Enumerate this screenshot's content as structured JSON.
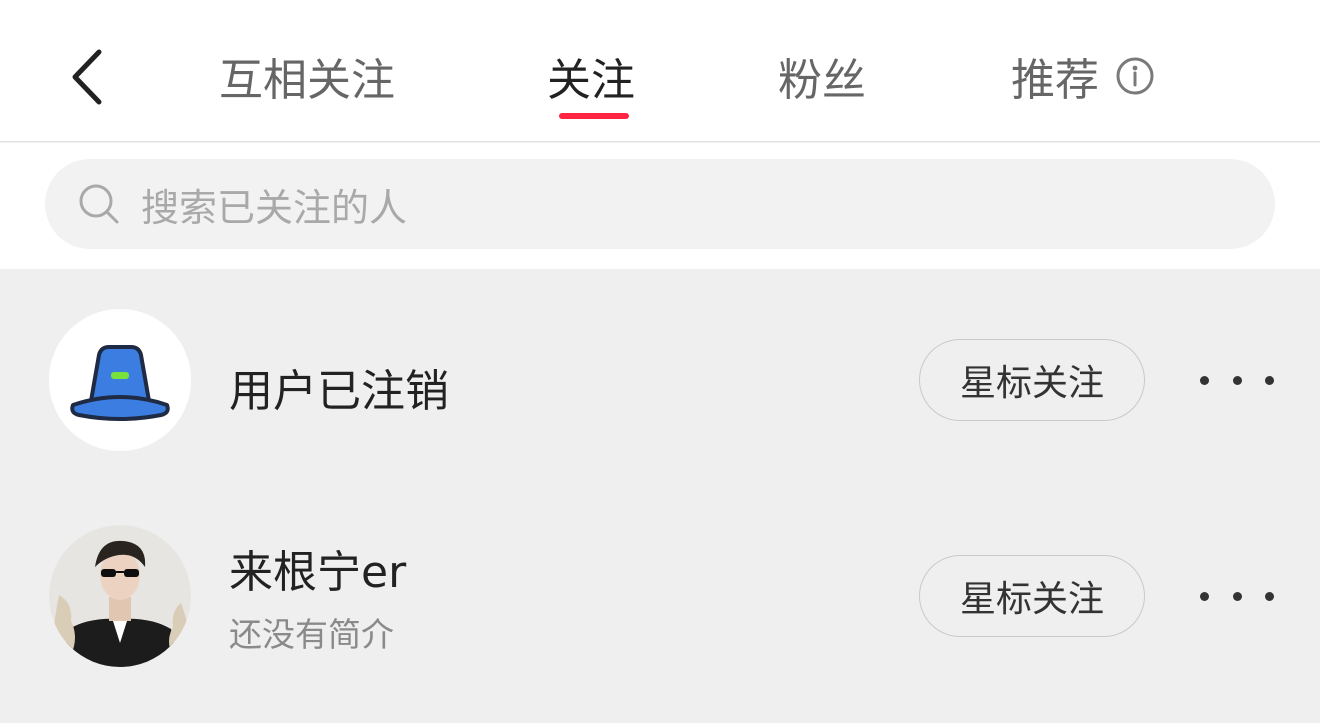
{
  "header": {
    "back_icon": "chevron-left-icon",
    "tabs": [
      {
        "label": "互相关注",
        "active": false
      },
      {
        "label": "关注",
        "active": true
      },
      {
        "label": "粉丝",
        "active": false
      },
      {
        "label": "推荐",
        "active": false
      }
    ],
    "info_icon": "info-icon",
    "accent_color": "#ff2442"
  },
  "search": {
    "icon": "search-icon",
    "placeholder": "搜索已关注的人"
  },
  "list": [
    {
      "name": "用户已注销",
      "bio": "",
      "avatar": "bucket-hat-avatar",
      "button_label": "星标关注",
      "more_icon": "more-icon"
    },
    {
      "name": "来根宁er",
      "bio": "还没有简介",
      "avatar": "photo-avatar",
      "button_label": "星标关注",
      "more_icon": "more-icon"
    }
  ]
}
